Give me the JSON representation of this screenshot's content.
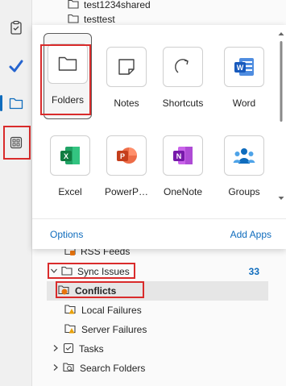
{
  "folder_pane": {
    "top_items": [
      "test1234shared",
      "testtest"
    ],
    "rss": "RSS Feeds",
    "sync_issues": "Sync Issues",
    "sync_count": "33",
    "conflicts": "Conflicts",
    "local_failures": "Local Failures",
    "server_failures": "Server Failures",
    "tasks": "Tasks",
    "search_folders": "Search Folders"
  },
  "apps_flyout": {
    "tiles": [
      {
        "label": "Folders",
        "icon": "folder-icon"
      },
      {
        "label": "Notes",
        "icon": "note-icon"
      },
      {
        "label": "Shortcuts",
        "icon": "shortcut-arrow-icon"
      },
      {
        "label": "Word",
        "icon": "word-icon"
      },
      {
        "label": "Excel",
        "icon": "excel-icon"
      },
      {
        "label": "PowerP…",
        "icon": "powerpoint-icon"
      },
      {
        "label": "OneNote",
        "icon": "onenote-icon"
      },
      {
        "label": "Groups",
        "icon": "groups-icon"
      }
    ],
    "options_label": "Options",
    "add_apps_label": "Add Apps"
  },
  "rail": {
    "icons": [
      "clipboard-icon",
      "checkmark-icon",
      "folder-icon",
      "apps-icon"
    ]
  },
  "colors": {
    "accent": "#0f6cbd",
    "highlight_red": "#d92b2b"
  }
}
